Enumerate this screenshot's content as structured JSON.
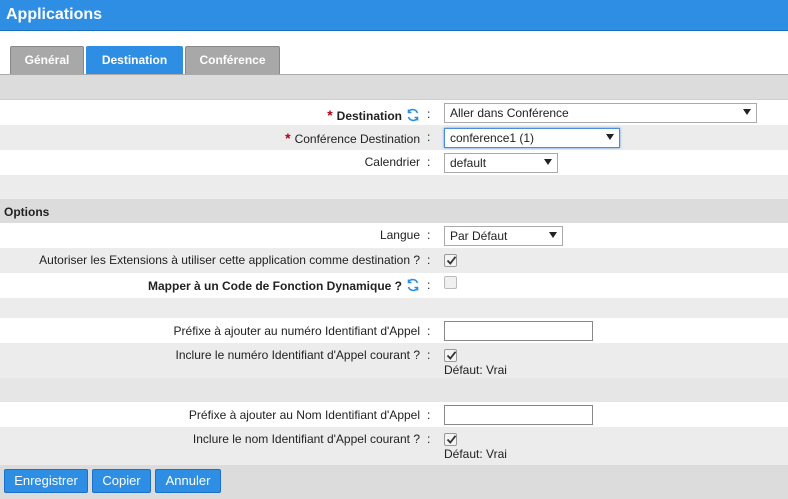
{
  "app": {
    "title": "Applications"
  },
  "tabs": [
    {
      "label": "Général",
      "active": false
    },
    {
      "label": "Destination",
      "active": true
    },
    {
      "label": "Conférence",
      "active": false
    }
  ],
  "form": {
    "destination": {
      "label": "Destination",
      "value": "Aller dans Conférence"
    },
    "conference_destination": {
      "label": "Conférence Destination",
      "value": "conference1 (1)"
    },
    "calendrier": {
      "label": "Calendrier",
      "value": "default"
    }
  },
  "options": {
    "title": "Options",
    "langue": {
      "label": "Langue",
      "value": "Par Défaut"
    },
    "autoriser_extensions": {
      "label": "Autoriser les Extensions à utiliser cette application comme destination ?",
      "checked": true
    },
    "mapper_code": {
      "label": "Mapper à un Code de Fonction Dynamique ?",
      "checked": false,
      "disabled": true
    },
    "prefixe_numero": {
      "label": "Préfixe à ajouter au numéro Identifiant d'Appel",
      "value": ""
    },
    "inclure_numero": {
      "label": "Inclure le numéro Identifiant d'Appel courant ?",
      "checked": true,
      "hint": "Défaut: Vrai"
    },
    "prefixe_nom": {
      "label": "Préfixe à ajouter au Nom Identifiant d'Appel",
      "value": ""
    },
    "inclure_nom": {
      "label": "Inclure le nom Identifiant d'Appel courant ?",
      "checked": true,
      "hint": "Défaut: Vrai"
    }
  },
  "colon": ":",
  "required_mark": "*",
  "buttons": {
    "save": "Enregistrer",
    "copy": "Copier",
    "cancel": "Annuler"
  },
  "colors": {
    "accent": "#2d8ee3",
    "required": "#b00018"
  },
  "icons": {
    "refresh": "refresh-icon",
    "checkmark": "checkmark-icon",
    "caret": "chevron-down-icon"
  }
}
